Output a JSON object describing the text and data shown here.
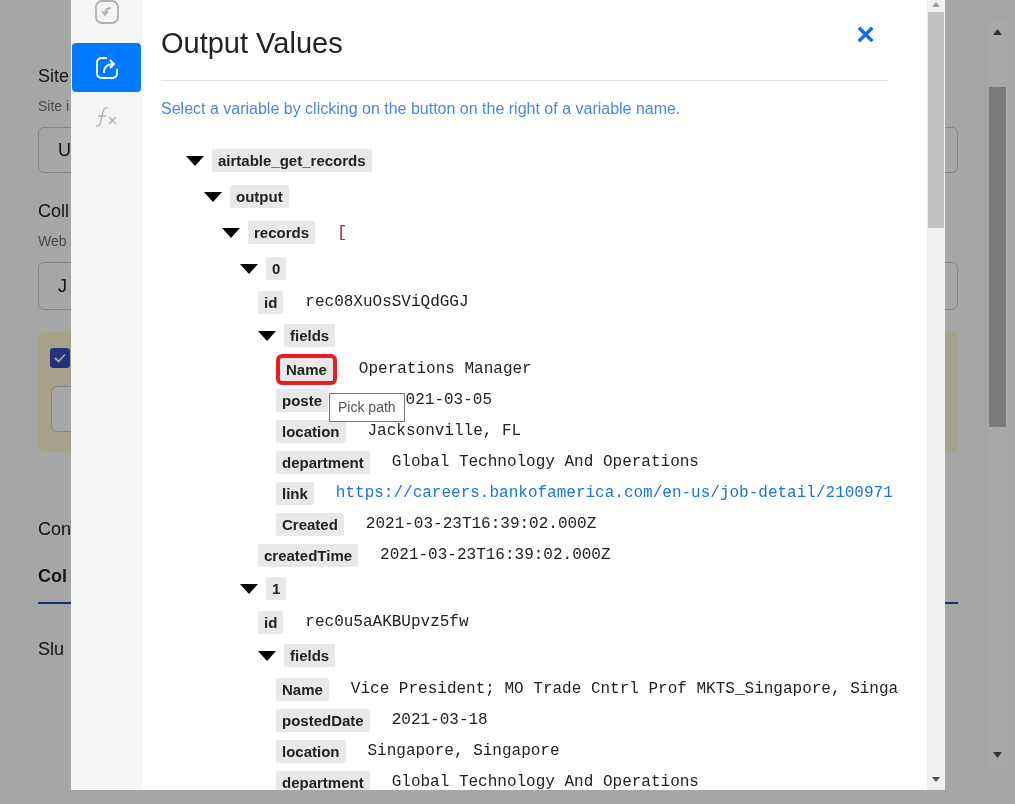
{
  "background": {
    "site_heading": "Site",
    "site_hint": "Site i",
    "site_select": "U",
    "collection_heading": "Coll",
    "collection_hint": "Web",
    "collection_select": "J",
    "option_checkbox": {
      "checked": true
    },
    "section_heading": "Con",
    "tabs": [
      {
        "label": "Col",
        "selected": true
      }
    ],
    "slug_label": "Slu"
  },
  "modal": {
    "title": "Output Values",
    "close": "×",
    "sidebar": [
      {
        "kind": "input",
        "selected": false
      },
      {
        "kind": "output",
        "selected": true
      },
      {
        "kind": "function",
        "selected": false
      }
    ],
    "instruction": "Select a variable by clicking on the button on the right of a variable name.",
    "tree": [
      {
        "key": "airtable_get_records",
        "kind": "branch",
        "expanded": true,
        "highlighted": false,
        "children": [
          {
            "key": "output",
            "kind": "branch",
            "expanded": true,
            "highlighted": false,
            "children": [
              {
                "key": "records",
                "kind": "branch",
                "value": "[",
                "expanded": true,
                "highlighted": false,
                "children": [
                  {
                    "key": "0",
                    "kind": "branch",
                    "expanded": true,
                    "highlighted": false,
                    "children": [
                      {
                        "key": "id",
                        "kind": "text",
                        "value": "rec08XuOsSViQdGGJ",
                        "highlighted": false
                      },
                      {
                        "key": "fields",
                        "kind": "branch",
                        "expanded": true,
                        "highlighted": false,
                        "children": [
                          {
                            "key": "Name",
                            "kind": "text",
                            "value": "Operations Manager",
                            "highlighted": true
                          },
                          {
                            "key": "poste",
                            "kind": "text",
                            "value": "021-03-05",
                            "highlighted": false
                          },
                          {
                            "key": "location",
                            "kind": "text",
                            "value": "Jacksonville, FL",
                            "highlighted": false
                          },
                          {
                            "key": "department",
                            "kind": "text",
                            "value": "Global Technology And Operations",
                            "highlighted": false
                          },
                          {
                            "key": "link",
                            "kind": "link",
                            "value": "https://careers.bankofamerica.com/en-us/job-detail/2100971",
                            "highlighted": false
                          },
                          {
                            "key": "Created",
                            "kind": "text",
                            "value": "2021-03-23T16:39:02.000Z",
                            "highlighted": false
                          }
                        ]
                      },
                      {
                        "key": "createdTime",
                        "kind": "text",
                        "value": "2021-03-23T16:39:02.000Z",
                        "highlighted": false
                      }
                    ]
                  },
                  {
                    "key": "1",
                    "kind": "branch",
                    "expanded": true,
                    "highlighted": false,
                    "children": [
                      {
                        "key": "id",
                        "kind": "text",
                        "value": "rec0u5aAKBUpvz5fw",
                        "highlighted": false
                      },
                      {
                        "key": "fields",
                        "kind": "branch",
                        "expanded": true,
                        "highlighted": false,
                        "children": [
                          {
                            "key": "Name",
                            "kind": "text",
                            "value": "Vice President; MO Trade Cntrl Prof MKTS_Singapore, Singa",
                            "highlighted": false
                          },
                          {
                            "key": "postedDate",
                            "kind": "text",
                            "value": "2021-03-18",
                            "highlighted": false
                          },
                          {
                            "key": "location",
                            "kind": "text",
                            "value": "Singapore, Singapore",
                            "highlighted": false
                          },
                          {
                            "key": "department",
                            "kind": "text",
                            "value": "Global Technology And Operations",
                            "highlighted": false
                          }
                        ]
                      }
                    ]
                  }
                ]
              }
            ]
          }
        ]
      }
    ],
    "tooltip": "Pick path"
  }
}
